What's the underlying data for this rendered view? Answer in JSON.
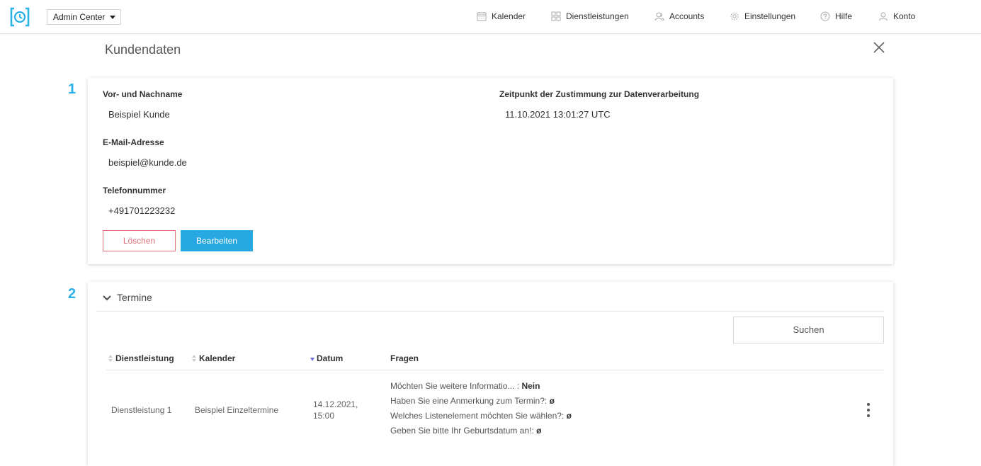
{
  "header": {
    "app_selector": "Admin Center",
    "nav": [
      {
        "label": "Kalender",
        "icon": "calendar-icon"
      },
      {
        "label": "Dienstleistungen",
        "icon": "grid-icon"
      },
      {
        "label": "Accounts",
        "icon": "users-icon"
      },
      {
        "label": "Einstellungen",
        "icon": "gear-icon"
      },
      {
        "label": "Hilfe",
        "icon": "help-icon"
      },
      {
        "label": "Konto",
        "icon": "user-icon"
      }
    ]
  },
  "modal": {
    "title": "Kundendaten"
  },
  "steps": [
    "1",
    "2"
  ],
  "customer": {
    "name_label": "Vor- und Nachname",
    "name_value": "Beispiel Kunde",
    "email_label": "E-Mail-Adresse",
    "email_value": "beispiel@kunde.de",
    "phone_label": "Telefonnummer",
    "phone_value": "+491701223232",
    "consent_label": "Zeitpunkt der Zustimmung zur Datenverarbeitung",
    "consent_value": "11.10.2021 13:01:27 UTC",
    "delete_label": "Löschen",
    "edit_label": "Bearbeiten"
  },
  "appointments": {
    "section_title": "Termine",
    "search_label": "Suchen",
    "columns": [
      "Dienstleistung",
      "Kalender",
      "Datum",
      "Fragen"
    ],
    "rows": [
      {
        "service": "Dienstleistung 1",
        "calendar": "Beispiel Einzeltermine",
        "date_line1": "14.12.2021,",
        "date_line2": "15:00",
        "questions": [
          {
            "q": "Möchten Sie weitere Informatio... :",
            "a": "Nein"
          },
          {
            "q": "Haben Sie eine Anmerkung zum Termin?:",
            "a": "ø"
          },
          {
            "q": "Welches Listenelement möchten Sie wählen?:",
            "a": "ø"
          },
          {
            "q": "Geben Sie bitte Ihr Geburtsdatum an!:",
            "a": "ø"
          }
        ]
      }
    ]
  },
  "colors": {
    "accent": "#28a8e0",
    "danger": "#e0707a",
    "step": "#28b0e8"
  }
}
